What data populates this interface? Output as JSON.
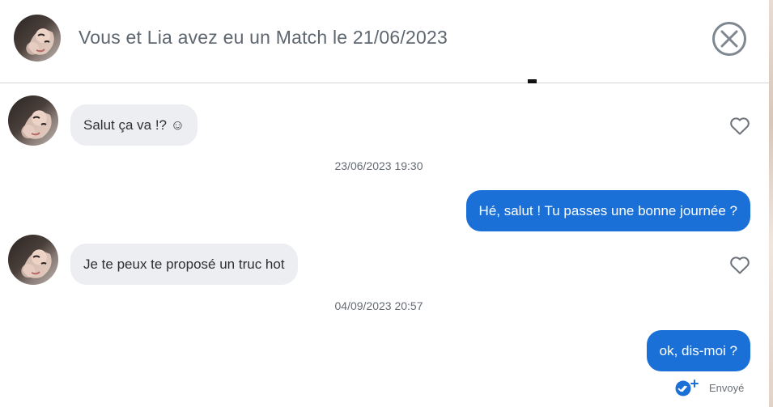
{
  "header": {
    "title": "Vous et Lia avez eu un Match le 21/06/2023",
    "close_icon": "close-circle-icon"
  },
  "messages": [
    {
      "direction": "incoming",
      "text": "Salut ça va !? ☺",
      "liked": false
    },
    {
      "timestamp": "23/06/2023 19:30"
    },
    {
      "direction": "outgoing",
      "text": "Hé, salut ! Tu passes une bonne journée ?"
    },
    {
      "direction": "incoming",
      "text": "Je te peux te proposé un truc hot",
      "liked": false
    },
    {
      "timestamp": "04/09/2023 20:57"
    },
    {
      "direction": "outgoing",
      "text": "ok, dis-moi ?"
    }
  ],
  "status": {
    "label": "Envoyé",
    "icon": "double-check-icon"
  },
  "colors": {
    "outgoing_bubble": "#1a70d6",
    "incoming_bubble": "#eceef2",
    "title": "#5e6670"
  }
}
